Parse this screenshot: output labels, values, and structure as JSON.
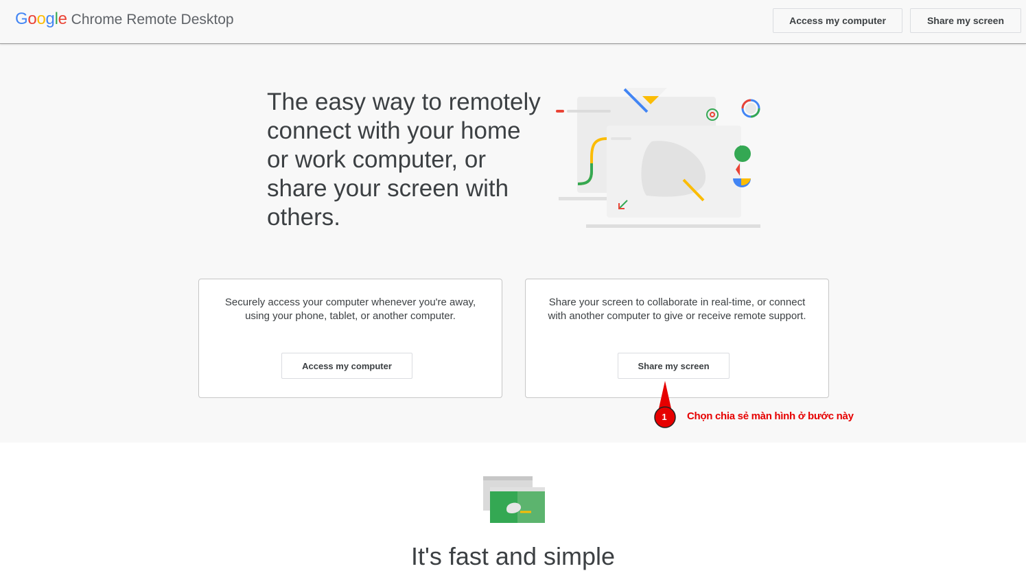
{
  "header": {
    "logo_text": "Google",
    "product_name": "Chrome Remote Desktop",
    "access_button": "Access my computer",
    "share_button": "Share my screen"
  },
  "hero": {
    "title": "The easy way to remotely connect with your home or work computer, or share your screen with others."
  },
  "cards": [
    {
      "description": "Securely access your computer whenever you're away, using your phone, tablet, or another computer.",
      "button": "Access my computer"
    },
    {
      "description": "Share your screen to collaborate in real-time, or connect with another computer to give or receive remote support.",
      "button": "Share my screen"
    }
  ],
  "annotation": {
    "step": "1",
    "text": "Chọn chia sẻ màn hình ở bước này",
    "color": "#e60000"
  },
  "lower": {
    "title": "It's fast and simple"
  },
  "colors": {
    "google_blue": "#4285f4",
    "google_red": "#ea4335",
    "google_yellow": "#fbbc05",
    "google_green": "#34a853",
    "text": "#3c4043"
  }
}
